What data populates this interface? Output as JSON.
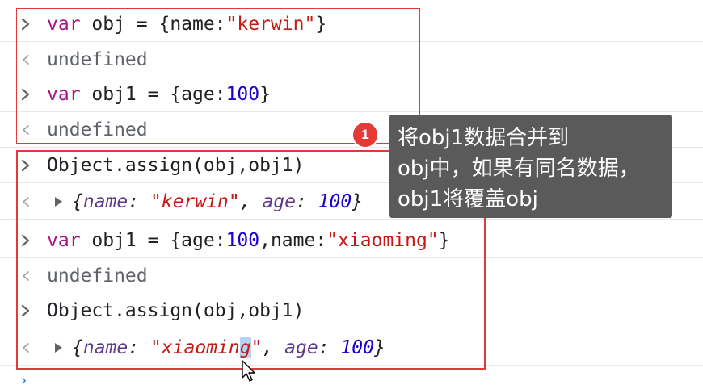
{
  "console": {
    "lines": [
      {
        "type": "input",
        "parts": [
          {
            "t": "var",
            "c": "kw"
          },
          {
            "t": " obj = {name:"
          },
          {
            "t": "\"kerwin\"",
            "c": "str"
          },
          {
            "t": "}"
          }
        ]
      },
      {
        "type": "output",
        "text": "undefined"
      },
      {
        "type": "input",
        "parts": [
          {
            "t": "var",
            "c": "kw"
          },
          {
            "t": " obj1 = {age:"
          },
          {
            "t": "100",
            "c": "num"
          },
          {
            "t": "}"
          }
        ]
      },
      {
        "type": "output",
        "text": "undefined"
      },
      {
        "type": "input",
        "parts": [
          {
            "t": "Object.assign(obj,obj1)"
          }
        ]
      },
      {
        "type": "result",
        "parts": [
          {
            "t": "{"
          },
          {
            "t": "name",
            "c": "key"
          },
          {
            "t": ": "
          },
          {
            "t": "\"kerwin\"",
            "c": "str"
          },
          {
            "t": ", "
          },
          {
            "t": "age",
            "c": "key"
          },
          {
            "t": ": "
          },
          {
            "t": "100",
            "c": "num"
          },
          {
            "t": "}"
          }
        ]
      },
      {
        "type": "input",
        "parts": [
          {
            "t": "var",
            "c": "kw"
          },
          {
            "t": " obj1 = {age:"
          },
          {
            "t": "100",
            "c": "num"
          },
          {
            "t": ",name:"
          },
          {
            "t": "\"xiaoming\"",
            "c": "str"
          },
          {
            "t": "}"
          }
        ]
      },
      {
        "type": "output",
        "text": "undefined"
      },
      {
        "type": "input",
        "parts": [
          {
            "t": "Object.assign(obj,obj1)"
          }
        ]
      },
      {
        "type": "result",
        "parts": [
          {
            "t": "{"
          },
          {
            "t": "name",
            "c": "key"
          },
          {
            "t": ": "
          },
          {
            "t": "\"xiaomin",
            "c": "str"
          },
          {
            "t": "g",
            "c": "str sel"
          },
          {
            "t": "\"",
            "c": "str"
          },
          {
            "t": ", "
          },
          {
            "t": "age",
            "c": "key"
          },
          {
            "t": ": "
          },
          {
            "t": "100",
            "c": "num"
          },
          {
            "t": "}"
          }
        ]
      }
    ]
  },
  "annotation": {
    "badge": "1",
    "lines": [
      "将obj1数据合并到",
      "obj中，如果有同名数据，",
      "obj1将覆盖obj"
    ]
  },
  "colors": {
    "highlight_box": "#e03b3b",
    "tooltip_bg": "#5a5a5a",
    "badge_bg": "#e53935"
  }
}
